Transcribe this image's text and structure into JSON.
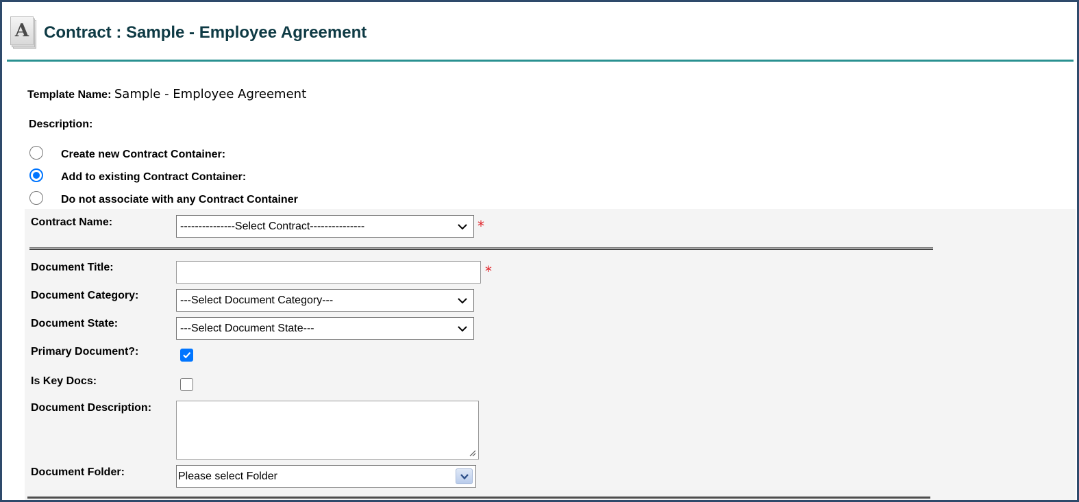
{
  "header": {
    "logo_letter": "A",
    "title": "Contract : Sample - Employee Agreement"
  },
  "template": {
    "label": "Template Name:",
    "value": "Sample - Employee Agreement"
  },
  "description": {
    "label": "Description:"
  },
  "container_options": [
    {
      "label": "Create new Contract Container:",
      "checked": false
    },
    {
      "label": "Add to existing Contract Container:",
      "checked": true
    },
    {
      "label": "Do not associate with any Contract Container",
      "checked": false
    }
  ],
  "form": {
    "contract_name": {
      "label": "Contract Name:",
      "value": "---------------Select Contract---------------",
      "required": "*"
    },
    "document_title": {
      "label": "Document Title:",
      "value": "",
      "required": "*"
    },
    "document_category": {
      "label": "Document Category:",
      "value": "---Select Document Category---"
    },
    "document_state": {
      "label": "Document State:",
      "value": "---Select Document State---"
    },
    "primary_document": {
      "label": "Primary Document?:",
      "checked": true
    },
    "is_key_docs": {
      "label": "Is Key Docs:",
      "checked": false
    },
    "document_description": {
      "label": "Document Description:",
      "value": ""
    },
    "document_folder": {
      "label": "Document Folder:",
      "value": "Please select Folder"
    }
  },
  "colors": {
    "frame_border": "#2e4a6b",
    "header_rule": "#2a9191",
    "title_text": "#0e3a44",
    "panel_bg": "#f4f4f4",
    "accent_blue": "#0075ff",
    "required_red": "#e0242a"
  },
  "icons": {
    "logo": "document-a-icon",
    "select_arrow": "chevron-down-icon",
    "checkbox_check": "check-icon",
    "textarea_grip": "resize-grip-icon"
  }
}
